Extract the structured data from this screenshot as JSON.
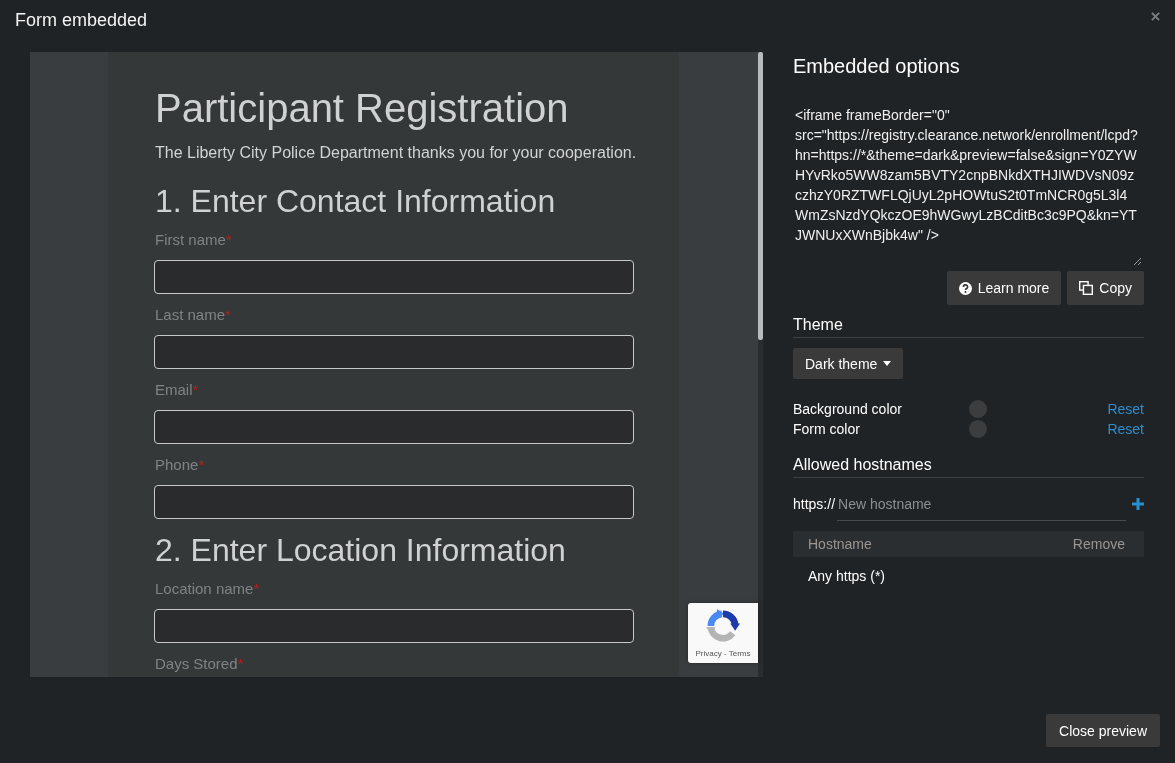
{
  "dialog": {
    "title": "Form embedded"
  },
  "preview": {
    "form": {
      "title": "Participant Registration",
      "subtitle": "The Liberty City Police Department thanks you for your cooperation.",
      "sections": [
        {
          "heading": "1. Enter Contact Information",
          "fields": [
            {
              "kind": "input",
              "label": "First name",
              "required_mark": "*"
            },
            {
              "kind": "input",
              "label": "Last name",
              "required_mark": "*"
            },
            {
              "kind": "input",
              "label": "Email",
              "required_mark": "*"
            },
            {
              "kind": "input",
              "label": "Phone",
              "required_mark": "*"
            }
          ]
        },
        {
          "heading": "2. Enter Location Information",
          "fields": [
            {
              "kind": "input",
              "label": "Location name",
              "required_mark": "*"
            },
            {
              "kind": "label",
              "label": "Days Stored",
              "required_mark": "*"
            }
          ]
        }
      ]
    },
    "recaptcha": {
      "links": "Privacy - Terms"
    }
  },
  "options": {
    "heading": "Embedded options",
    "embed_code": "<iframe frameBorder=\"0\" src=\"https://registry.clearance.network/enrollment/lcpd?hn=https://*&theme=dark&preview=false&sign=Y0ZYWHYvRko5WW8zam5BVTY2cnpBNkdXTHJIWDVsN09zczhzY0RZTWFLQjUyL2pHOWtuS2t0TmNCR0g5L3l4WmZsNzdYQkczOE9hWGwyLzBCditBc3c9PQ&kn=YTJWNUxXWnBjbk4w\" />",
    "buttons": [
      {
        "kind": "help",
        "label": "Learn more"
      },
      {
        "kind": "copy",
        "label": "Copy"
      }
    ]
  },
  "theme": {
    "heading": "Theme",
    "dropdown": "Dark theme",
    "colors": [
      {
        "label": "Background color",
        "color": "#3b3d3f",
        "reset": "Reset"
      },
      {
        "label": "Form color",
        "color": "#3b3d3f",
        "reset": "Reset"
      }
    ]
  },
  "hostnames": {
    "heading": "Allowed hostnames",
    "prefix": "https://",
    "placeholder": "New hostname",
    "table": {
      "columns": [
        "Hostname",
        "Remove"
      ],
      "rows": [
        {
          "hostname": "Any https (*)"
        }
      ]
    }
  },
  "footer": {
    "close_button": "Close preview"
  }
}
